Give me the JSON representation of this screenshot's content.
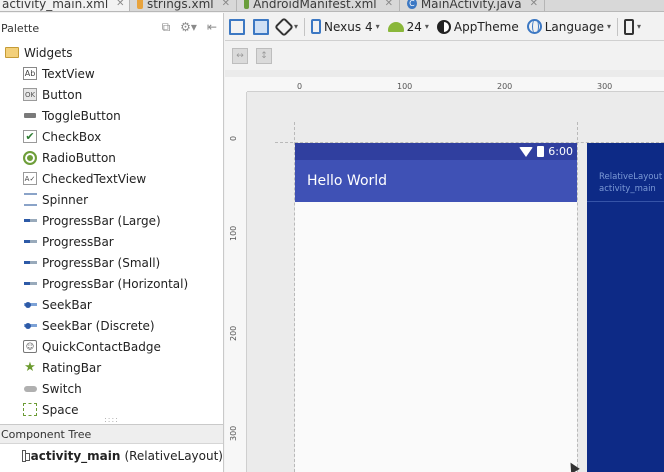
{
  "tabs": [
    {
      "label": "activity_main.xml",
      "active": true,
      "color": "#e8a33d"
    },
    {
      "label": "strings.xml",
      "active": false,
      "color": "#e8a33d"
    },
    {
      "label": "AndroidManifest.xml",
      "active": false,
      "color": "#6a9e3c"
    },
    {
      "label": "MainActivity.java",
      "active": false,
      "color": "#3c78c3",
      "icon_letter": "C"
    }
  ],
  "palette": {
    "title": "Palette",
    "group": "Widgets",
    "items": [
      {
        "label": "TextView",
        "icon": "textview-icon",
        "glyph": "Ab"
      },
      {
        "label": "Button",
        "icon": "button-icon",
        "glyph": "OK"
      },
      {
        "label": "ToggleButton",
        "icon": "toggle-button-icon",
        "glyph": ""
      },
      {
        "label": "CheckBox",
        "icon": "checkbox-icon",
        "glyph": "✔"
      },
      {
        "label": "RadioButton",
        "icon": "radio-button-icon",
        "glyph": ""
      },
      {
        "label": "CheckedTextView",
        "icon": "checked-textview-icon",
        "glyph": "A✓"
      },
      {
        "label": "Spinner",
        "icon": "spinner-icon",
        "glyph": ""
      },
      {
        "label": "ProgressBar (Large)",
        "icon": "progressbar-icon",
        "glyph": ""
      },
      {
        "label": "ProgressBar",
        "icon": "progressbar-icon",
        "glyph": ""
      },
      {
        "label": "ProgressBar (Small)",
        "icon": "progressbar-icon",
        "glyph": ""
      },
      {
        "label": "ProgressBar (Horizontal)",
        "icon": "progressbar-icon",
        "glyph": ""
      },
      {
        "label": "SeekBar",
        "icon": "seekbar-icon",
        "glyph": ""
      },
      {
        "label": "SeekBar (Discrete)",
        "icon": "seekbar-icon",
        "glyph": ""
      },
      {
        "label": "QuickContactBadge",
        "icon": "quick-contact-badge-icon",
        "glyph": "☺"
      },
      {
        "label": "RatingBar",
        "icon": "star-icon",
        "glyph": "★"
      },
      {
        "label": "Switch",
        "icon": "switch-icon",
        "glyph": ""
      },
      {
        "label": "Space",
        "icon": "space-icon",
        "glyph": ""
      }
    ]
  },
  "component_tree": {
    "title": "Component Tree",
    "root_id": "activity_main",
    "root_type": "(RelativeLayout)"
  },
  "toolbar": {
    "device": "Nexus 4",
    "api": "24",
    "theme": "AppTheme",
    "language": "Language"
  },
  "ruler": {
    "top_ticks": [
      "0",
      "100",
      "200",
      "300"
    ],
    "left_ticks": [
      "0",
      "100",
      "200",
      "300"
    ]
  },
  "preview": {
    "status_time": "6:00",
    "app_title": "Hello World",
    "primary_color": "#3f51b5",
    "status_color": "#303f9f"
  },
  "blueprint": {
    "line1": "RelativeLayout",
    "line2": "activity_main",
    "color": "#0d2a86"
  }
}
